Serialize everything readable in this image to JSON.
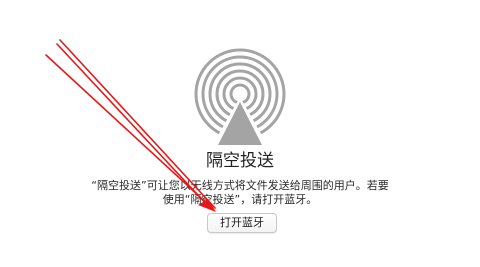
{
  "airdrop": {
    "icon": "airdrop-icon",
    "title": "隔空投送",
    "description_line1": "“隔空投送”可让您以无线方式将文件发送给周围的用户。若要",
    "description_line2": "使用“隔空投送”，请打开蓝牙。",
    "button_label": "打开蓝牙"
  },
  "annotation": {
    "color": "#e01b1b"
  }
}
